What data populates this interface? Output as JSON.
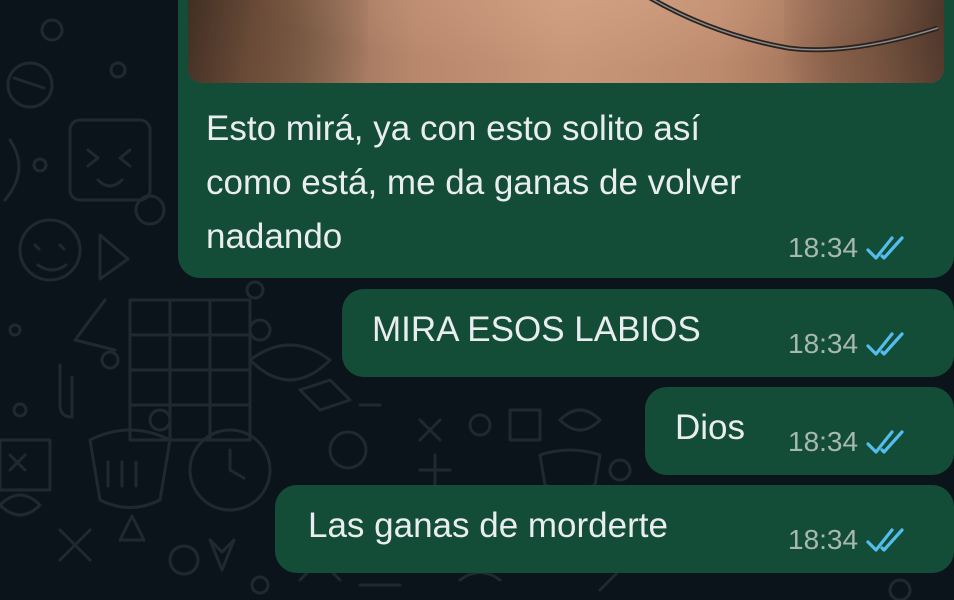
{
  "chat": {
    "messages": [
      {
        "type": "image-with-caption",
        "text_lines": [
          "Esto mirá, ya con esto solito así",
          "como está, me da ganas de volver",
          "nadando"
        ],
        "time": "18:34",
        "status": "read"
      },
      {
        "type": "text",
        "text": "MIRA ESOS LABIOS",
        "time": "18:34",
        "status": "read"
      },
      {
        "type": "text",
        "text": "Dios",
        "time": "18:34",
        "status": "read"
      },
      {
        "type": "text",
        "text": "Las ganas de morderte",
        "time": "18:34",
        "status": "read"
      }
    ]
  },
  "colors": {
    "background": "#0b141a",
    "outgoing_bubble": "#144d37",
    "text": "#e9edef",
    "timestamp": "#a7b7b1",
    "read_ticks": "#53bdeb"
  },
  "icons": {
    "read_receipt": "double-check-icon"
  }
}
